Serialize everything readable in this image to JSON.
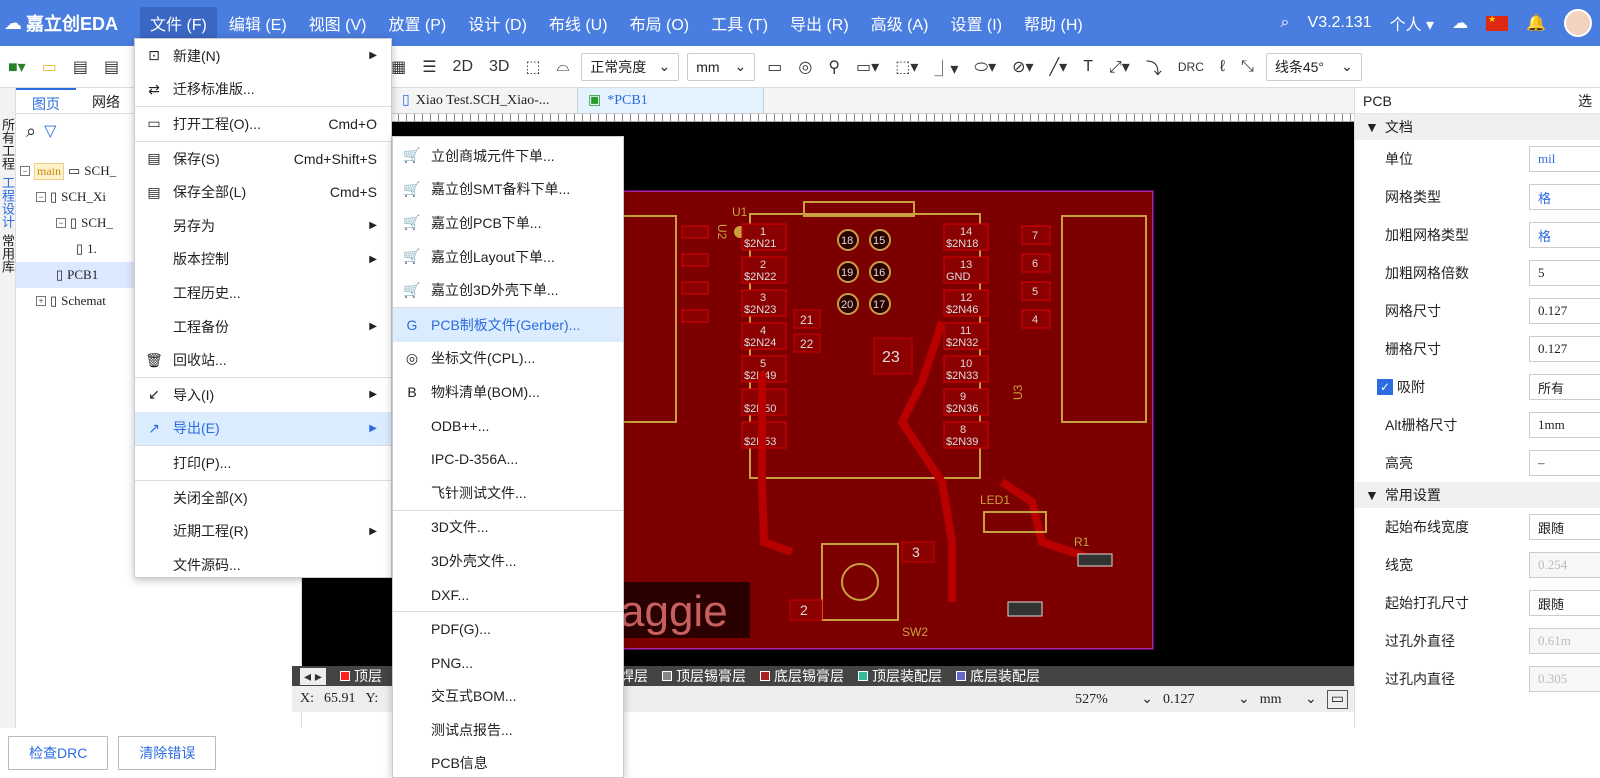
{
  "app": {
    "logo_text": "嘉立创EDA",
    "version": "V3.2.131",
    "user_label": "个人"
  },
  "menu": [
    "文件 (F)",
    "编辑 (E)",
    "视图 (V)",
    "放置 (P)",
    "设计 (D)",
    "布线 (U)",
    "布局 (O)",
    "工具 (T)",
    "导出 (R)",
    "高级 (A)",
    "设置 (I)",
    "帮助 (H)"
  ],
  "toolbar": {
    "b2d": "2D",
    "b3d": "3D",
    "brightness": "正常亮度",
    "unit": "mm",
    "drc": "DRC",
    "routing": "线条45°"
  },
  "left_strip": [
    "所有工程",
    "工程设计",
    "常用库"
  ],
  "left_tabs": [
    "图页",
    "网络"
  ],
  "tree": [
    {
      "label": "SCH_",
      "badge": "main",
      "indent": 4,
      "exp": "⊟"
    },
    {
      "label": "SCH_Xi",
      "indent": 20,
      "exp": "⊟"
    },
    {
      "label": "SCH_",
      "indent": 40,
      "exp": "⊟"
    },
    {
      "label": "1.",
      "indent": 60,
      "exp": ""
    },
    {
      "label": "PCB1",
      "indent": 40,
      "exp": "",
      "sel": true
    },
    {
      "label": "Schemat",
      "indent": 20,
      "exp": "⊞"
    }
  ],
  "bottom_buttons": [
    "检查DRC",
    "清除错误"
  ],
  "doc_tabs": [
    "Xiao Test.SCH_Xiao-...",
    "*PCB1"
  ],
  "layers": [
    "顶层",
    "丝印层",
    "顶层阻焊层",
    "底层阻焊层",
    "顶层锡膏层",
    "底层锡膏层",
    "顶层装配层",
    "底层装配层"
  ],
  "layer_colors": [
    "#ff2020",
    "#e0e000",
    "#cc22cc",
    "#a020f0",
    "#888888",
    "#aa2222",
    "#33bb99",
    "#6666cc"
  ],
  "status": {
    "x_label": "X:",
    "x_value": "65.91",
    "y_label": "Y:",
    "zoom": "527%",
    "grid": "0.127",
    "unit": "mm"
  },
  "pcb": {
    "u1": "U1",
    "u2": "U2",
    "u3": "U3",
    "led1": "LED1",
    "r1": "R1",
    "sw2": "SW2",
    "maggie": "aggie",
    "left_pads": [
      {
        "n": "1",
        "net": "$2N21"
      },
      {
        "n": "2",
        "net": "$2N22"
      },
      {
        "n": "3",
        "net": "$2N23"
      },
      {
        "n": "4",
        "net": "$2N24"
      },
      {
        "n": "5",
        "net": "$2N49"
      },
      {
        "n": "6",
        "net": "$2N50"
      },
      {
        "n": "7",
        "net": "$2N53"
      }
    ],
    "right_pads": [
      {
        "n": "14",
        "net": "$2N18"
      },
      {
        "n": "13",
        "net": "GND"
      },
      {
        "n": "12",
        "net": "$2N46"
      },
      {
        "n": "11",
        "net": "$2N32"
      },
      {
        "n": "10",
        "net": "$2N33"
      },
      {
        "n": "9",
        "net": "$2N36"
      },
      {
        "n": "8",
        "net": "$2N39"
      }
    ],
    "mid_pads": [
      "18",
      "15",
      "19",
      "16",
      "20",
      "17"
    ],
    "pad21": "21",
    "pad22": "22",
    "pad23": "23",
    "sw_pad3": "3",
    "sw_pad2": "2",
    "side_pads": [
      "7",
      "6",
      "5",
      "4"
    ]
  },
  "right_panel": {
    "header": "PCB",
    "header_right": "选",
    "sec_doc": "文档",
    "rows": [
      {
        "label": "单位",
        "value": "mil",
        "style": "blue"
      },
      {
        "label": "网格类型",
        "value": "格",
        "style": "blue"
      },
      {
        "label": "加粗网格类型",
        "value": "格",
        "style": "blue"
      },
      {
        "label": "加粗网格倍数",
        "value": "5",
        "style": ""
      },
      {
        "label": "网格尺寸",
        "value": "0.127",
        "style": ""
      },
      {
        "label": "栅格尺寸",
        "value": "0.127",
        "style": ""
      },
      {
        "label": "吸附",
        "value": "所有",
        "style": "",
        "check": true
      },
      {
        "label": "Alt栅格尺寸",
        "value": "1mm",
        "style": ""
      },
      {
        "label": "高亮",
        "value": "–",
        "style": ""
      }
    ],
    "sec_common": "常用设置",
    "rows2": [
      {
        "label": "起始布线宽度",
        "value": "跟随",
        "style": ""
      },
      {
        "label": "线宽",
        "value": "0.254",
        "style": "dis"
      },
      {
        "label": "起始打孔尺寸",
        "value": "跟随",
        "style": ""
      },
      {
        "label": "过孔外直径",
        "value": "0.61m",
        "style": "dis"
      },
      {
        "label": "过孔内直径",
        "value": "0.305",
        "style": "dis"
      }
    ]
  },
  "file_menu": [
    {
      "label": "新建(N)",
      "shortcut": "",
      "arrow": true,
      "icon": "new-file-icon",
      "g": "⊡"
    },
    {
      "label": "迁移标准版...",
      "shortcut": "",
      "icon": "migrate-icon",
      "g": "⇄",
      "sep": true
    },
    {
      "label": "打开工程(O)...",
      "shortcut": "Cmd+O",
      "icon": "folder-icon",
      "g": "▭",
      "sep": true
    },
    {
      "label": "保存(S)",
      "shortcut": "Cmd+Shift+S",
      "icon": "save-icon",
      "g": "▤"
    },
    {
      "label": "保存全部(L)",
      "shortcut": "Cmd+S",
      "icon": "save-all-icon",
      "g": "▤"
    },
    {
      "label": "另存为",
      "shortcut": "",
      "arrow": true,
      "icon": "",
      "g": ""
    },
    {
      "label": "版本控制",
      "shortcut": "",
      "arrow": true,
      "icon": "",
      "g": ""
    },
    {
      "label": "工程历史...",
      "shortcut": "",
      "icon": "",
      "g": ""
    },
    {
      "label": "工程备份",
      "shortcut": "",
      "arrow": true,
      "icon": "",
      "g": ""
    },
    {
      "label": "回收站...",
      "shortcut": "",
      "icon": "trash-icon",
      "g": "🗑",
      "sep": true
    },
    {
      "label": "导入(I)",
      "shortcut": "",
      "arrow": true,
      "icon": "import-icon",
      "g": "↙"
    },
    {
      "label": "导出(E)",
      "shortcut": "",
      "arrow": true,
      "icon": "export-icon",
      "g": "↗",
      "hl": true,
      "sep": true
    },
    {
      "label": "打印(P)...",
      "shortcut": "",
      "icon": "",
      "g": "",
      "sep": true
    },
    {
      "label": "关闭全部(X)",
      "shortcut": "",
      "icon": "",
      "g": ""
    },
    {
      "label": "近期工程(R)",
      "shortcut": "",
      "arrow": true,
      "icon": "",
      "g": ""
    },
    {
      "label": "文件源码...",
      "shortcut": "",
      "icon": "",
      "g": ""
    }
  ],
  "export_menu": [
    {
      "label": "立创商城元件下单...",
      "icon": "cart-icon",
      "g": "🛒"
    },
    {
      "label": "嘉立创SMT备料下单...",
      "icon": "cart-icon",
      "g": "🛒"
    },
    {
      "label": "嘉立创PCB下单...",
      "icon": "order-icon",
      "g": "🛒"
    },
    {
      "label": "嘉立创Layout下单...",
      "icon": "order-icon",
      "g": "🛒"
    },
    {
      "label": "嘉立创3D外壳下单...",
      "icon": "cart-icon",
      "g": "🛒",
      "sep": true
    },
    {
      "label": "PCB制板文件(Gerber)...",
      "icon": "gerber-icon",
      "g": "G",
      "hl": true
    },
    {
      "label": "坐标文件(CPL)...",
      "icon": "cpl-icon",
      "g": "◎"
    },
    {
      "label": "物料清单(BOM)...",
      "icon": "bom-icon",
      "g": "B"
    },
    {
      "label": "ODB++...",
      "icon": "",
      "g": ""
    },
    {
      "label": "IPC-D-356A...",
      "icon": "",
      "g": ""
    },
    {
      "label": "飞针测试文件...",
      "icon": "",
      "g": "",
      "sep": true
    },
    {
      "label": "3D文件...",
      "icon": "",
      "g": ""
    },
    {
      "label": "3D外壳文件...",
      "icon": "",
      "g": ""
    },
    {
      "label": "DXF...",
      "icon": "",
      "g": "",
      "sep": true
    },
    {
      "label": "PDF(G)...",
      "icon": "",
      "g": ""
    },
    {
      "label": "PNG...",
      "icon": "",
      "g": ""
    },
    {
      "label": "交互式BOM...",
      "icon": "",
      "g": ""
    },
    {
      "label": "测试点报告...",
      "icon": "",
      "g": ""
    },
    {
      "label": "PCB信息",
      "icon": "",
      "g": ""
    }
  ]
}
